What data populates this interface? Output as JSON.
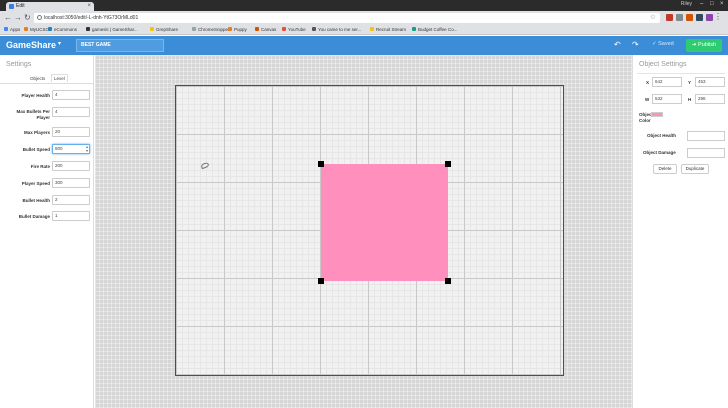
{
  "browser": {
    "tab_title": "Edit",
    "user_name": "Riley",
    "url": "localhost:3050/edit/-L-dnh-YtG73OrMLd01",
    "bookmarks": [
      "Apps",
      "MyUCSC",
      "eCommons",
      "gameslc | GameShar...",
      "GrepShare",
      "ChromeSnipper",
      "Puppy",
      "Canvas",
      "YouTube",
      "You came to me ser...",
      "Recruit Stream",
      "Budget Coffee Co..."
    ]
  },
  "header": {
    "brand": "GameShare",
    "game_title": "BEST GAME",
    "saved_label": "Saved",
    "publish_label": "Publish"
  },
  "settings": {
    "title": "Settings",
    "tab_objects": "Objects",
    "tab_level": "Level",
    "fields": [
      {
        "label": "Player Health",
        "value": "4"
      },
      {
        "label": "Max Bullets Per Player",
        "value": "4"
      },
      {
        "label": "Max Players",
        "value": "20"
      },
      {
        "label": "Bullet Speed",
        "value": "800"
      },
      {
        "label": "Fire Rate",
        "value": "200"
      },
      {
        "label": "Player Speed",
        "value": "300"
      },
      {
        "label": "Bullet Health",
        "value": "2"
      },
      {
        "label": "Bullet Damage",
        "value": "1"
      }
    ]
  },
  "object_settings": {
    "title": "Object Settings",
    "x_label": "X",
    "x_value": "642",
    "y_label": "Y",
    "y_value": "453",
    "w_label": "W",
    "w_value": "532",
    "h_label": "H",
    "h_value": "296",
    "color_label": "Object Color",
    "color_value": "#ff8fbd",
    "health_label": "Object Health",
    "damage_label": "Object Damage",
    "delete_label": "Delete",
    "duplicate_label": "Duplicate"
  }
}
